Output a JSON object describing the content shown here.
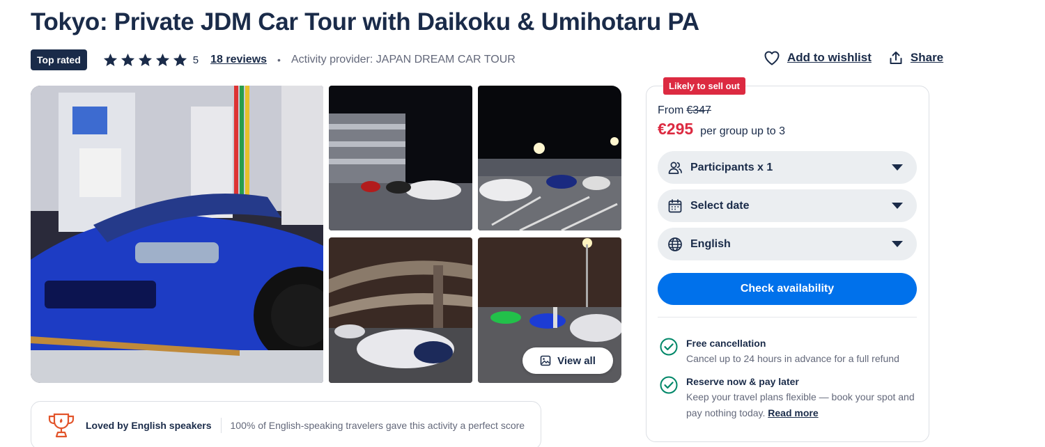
{
  "title": "Tokyo: Private JDM Car Tour with Daikoku & Umihotaru PA",
  "meta": {
    "badge": "Top rated",
    "stars": 5,
    "rating": "5",
    "reviews": "18 reviews",
    "separator": "•",
    "provider": "Activity provider: JAPAN DREAM CAR TOUR"
  },
  "actions": {
    "wishlist": "Add to wishlist",
    "share": "Share"
  },
  "gallery": {
    "view_all": "View all"
  },
  "loved": {
    "label": "Loved by English speakers",
    "description": "100% of English-speaking travelers gave this activity a perfect score"
  },
  "booking": {
    "badge": "Likely to sell out",
    "from_label": "From",
    "old_price": "€347",
    "price": "€295",
    "price_unit": "per group up to 3",
    "participants": "Participants x 1",
    "date": "Select date",
    "language": "English",
    "cta": "Check availability",
    "features": [
      {
        "title": "Free cancellation",
        "description": "Cancel up to 24 hours in advance for a full refund"
      },
      {
        "title": "Reserve now & pay later",
        "description": "Keep your travel plans flexible — book your spot and pay nothing today.",
        "link": "Read more"
      }
    ]
  },
  "colors": {
    "navy": "#1a2b49",
    "accent_blue": "#0071eb",
    "sale_red": "#dc2a41",
    "check_green": "#008768",
    "muted": "#63687a"
  },
  "icons": {
    "star": "star-icon",
    "wishlist": "heart-icon",
    "share": "share-icon",
    "view_all": "image-icon",
    "loved": "trophy-icon",
    "participants": "people-icon",
    "date": "calendar-icon",
    "language": "globe-icon",
    "check": "check-circle-icon"
  }
}
